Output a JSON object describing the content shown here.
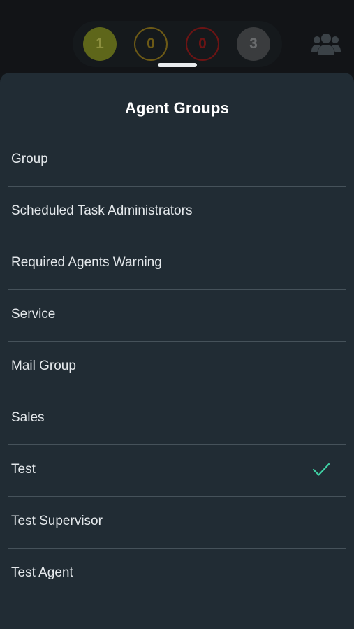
{
  "status_bar": {
    "counters": [
      {
        "value": "1",
        "color": "#5e661a"
      },
      {
        "value": "0",
        "color": "#6d5a16"
      },
      {
        "value": "0",
        "color": "#6d1414"
      },
      {
        "value": "3",
        "color": "#3a3c3e"
      }
    ],
    "team_icon": "people-group-icon"
  },
  "sheet": {
    "title": "Agent Groups",
    "items": [
      {
        "label": "Group",
        "selected": false
      },
      {
        "label": "Scheduled Task Administrators",
        "selected": false
      },
      {
        "label": "Required Agents Warning",
        "selected": false
      },
      {
        "label": "Service",
        "selected": false
      },
      {
        "label": "Mail Group",
        "selected": false
      },
      {
        "label": "Sales",
        "selected": false
      },
      {
        "label": "Test",
        "selected": true
      },
      {
        "label": "Test Supervisor",
        "selected": false
      },
      {
        "label": "Test Agent",
        "selected": false
      }
    ],
    "check_icon": "checkmark-icon",
    "accent_color": "#3fd1a4"
  }
}
